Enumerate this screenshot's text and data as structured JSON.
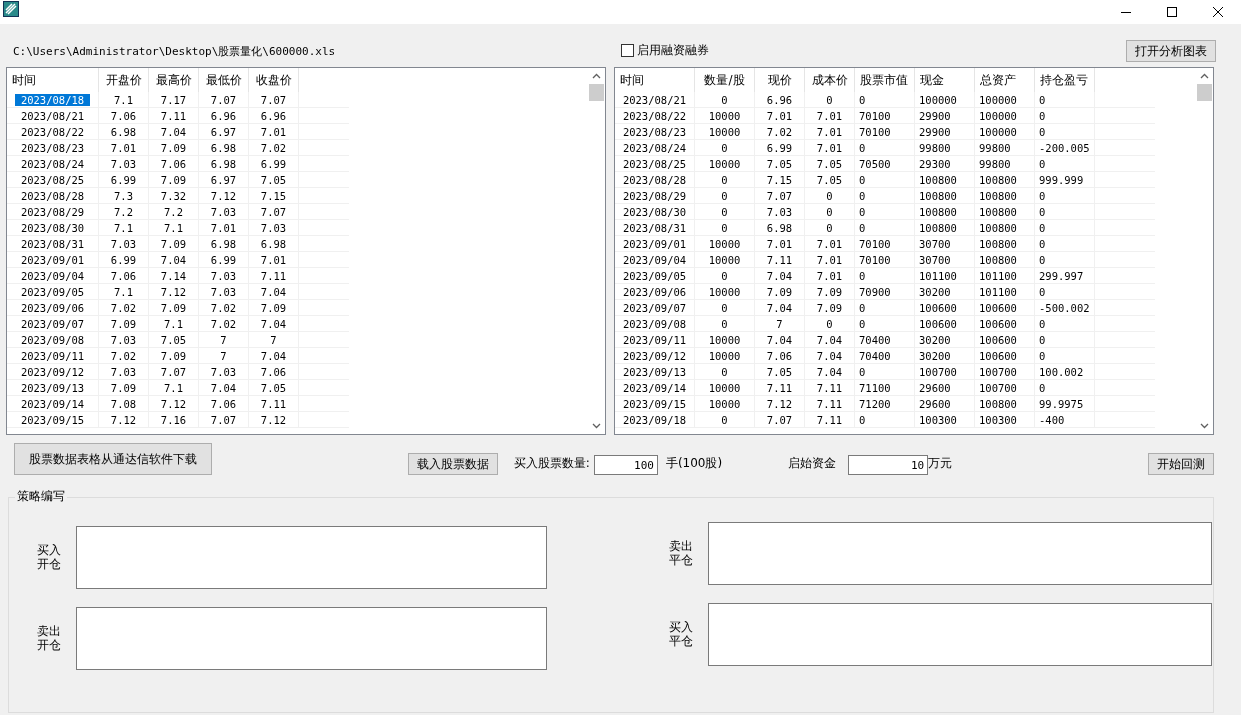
{
  "file_path": "C:\\Users\\Administrator\\Desktop\\股票量化\\600000.xls",
  "margin_option": {
    "label": "启用融资融券",
    "checked": false
  },
  "chart_button": "打开分析图表",
  "price_table": {
    "columns": [
      "时间",
      "开盘价",
      "最高价",
      "最低价",
      "收盘价"
    ],
    "rows": [
      {
        "selected": true,
        "cells": [
          "2023/08/18",
          "7.1",
          "7.17",
          "7.07",
          "7.07"
        ]
      },
      {
        "selected": false,
        "cells": [
          "2023/08/21",
          "7.06",
          "7.11",
          "6.96",
          "6.96"
        ]
      },
      {
        "selected": false,
        "cells": [
          "2023/08/22",
          "6.98",
          "7.04",
          "6.97",
          "7.01"
        ]
      },
      {
        "selected": false,
        "cells": [
          "2023/08/23",
          "7.01",
          "7.09",
          "6.98",
          "7.02"
        ]
      },
      {
        "selected": false,
        "cells": [
          "2023/08/24",
          "7.03",
          "7.06",
          "6.98",
          "6.99"
        ]
      },
      {
        "selected": false,
        "cells": [
          "2023/08/25",
          "6.99",
          "7.09",
          "6.97",
          "7.05"
        ]
      },
      {
        "selected": false,
        "cells": [
          "2023/08/28",
          "7.3",
          "7.32",
          "7.12",
          "7.15"
        ]
      },
      {
        "selected": false,
        "cells": [
          "2023/08/29",
          "7.2",
          "7.2",
          "7.03",
          "7.07"
        ]
      },
      {
        "selected": false,
        "cells": [
          "2023/08/30",
          "7.1",
          "7.1",
          "7.01",
          "7.03"
        ]
      },
      {
        "selected": false,
        "cells": [
          "2023/08/31",
          "7.03",
          "7.09",
          "6.98",
          "6.98"
        ]
      },
      {
        "selected": false,
        "cells": [
          "2023/09/01",
          "6.99",
          "7.04",
          "6.99",
          "7.01"
        ]
      },
      {
        "selected": false,
        "cells": [
          "2023/09/04",
          "7.06",
          "7.14",
          "7.03",
          "7.11"
        ]
      },
      {
        "selected": false,
        "cells": [
          "2023/09/05",
          "7.1",
          "7.12",
          "7.03",
          "7.04"
        ]
      },
      {
        "selected": false,
        "cells": [
          "2023/09/06",
          "7.02",
          "7.09",
          "7.02",
          "7.09"
        ]
      },
      {
        "selected": false,
        "cells": [
          "2023/09/07",
          "7.09",
          "7.1",
          "7.02",
          "7.04"
        ]
      },
      {
        "selected": false,
        "cells": [
          "2023/09/08",
          "7.03",
          "7.05",
          "7",
          "7"
        ]
      },
      {
        "selected": false,
        "cells": [
          "2023/09/11",
          "7.02",
          "7.09",
          "7",
          "7.04"
        ]
      },
      {
        "selected": false,
        "cells": [
          "2023/09/12",
          "7.03",
          "7.07",
          "7.03",
          "7.06"
        ]
      },
      {
        "selected": false,
        "cells": [
          "2023/09/13",
          "7.09",
          "7.1",
          "7.04",
          "7.05"
        ]
      },
      {
        "selected": false,
        "cells": [
          "2023/09/14",
          "7.08",
          "7.12",
          "7.06",
          "7.11"
        ]
      },
      {
        "selected": false,
        "cells": [
          "2023/09/15",
          "7.12",
          "7.16",
          "7.07",
          "7.12"
        ]
      }
    ]
  },
  "result_table": {
    "columns": [
      "时间",
      "数量/股",
      "现价",
      "成本价",
      "股票市值",
      "现金",
      "总资产",
      "持仓盈亏"
    ],
    "rows": [
      {
        "selected": false,
        "cells": [
          "2023/08/21",
          "0",
          "6.96",
          "0",
          "0",
          "100000",
          "100000",
          "0"
        ]
      },
      {
        "selected": false,
        "cells": [
          "2023/08/22",
          "10000",
          "7.01",
          "7.01",
          "70100",
          "29900",
          "100000",
          "0"
        ]
      },
      {
        "selected": false,
        "cells": [
          "2023/08/23",
          "10000",
          "7.02",
          "7.01",
          "70100",
          "29900",
          "100000",
          "0"
        ]
      },
      {
        "selected": false,
        "cells": [
          "2023/08/24",
          "0",
          "6.99",
          "7.01",
          "0",
          "99800",
          "99800",
          "-200.005"
        ]
      },
      {
        "selected": false,
        "cells": [
          "2023/08/25",
          "10000",
          "7.05",
          "7.05",
          "70500",
          "29300",
          "99800",
          "0"
        ]
      },
      {
        "selected": false,
        "cells": [
          "2023/08/28",
          "0",
          "7.15",
          "7.05",
          "0",
          "100800",
          "100800",
          "999.999"
        ]
      },
      {
        "selected": false,
        "cells": [
          "2023/08/29",
          "0",
          "7.07",
          "0",
          "0",
          "100800",
          "100800",
          "0"
        ]
      },
      {
        "selected": false,
        "cells": [
          "2023/08/30",
          "0",
          "7.03",
          "0",
          "0",
          "100800",
          "100800",
          "0"
        ]
      },
      {
        "selected": false,
        "cells": [
          "2023/08/31",
          "0",
          "6.98",
          "0",
          "0",
          "100800",
          "100800",
          "0"
        ]
      },
      {
        "selected": false,
        "cells": [
          "2023/09/01",
          "10000",
          "7.01",
          "7.01",
          "70100",
          "30700",
          "100800",
          "0"
        ]
      },
      {
        "selected": false,
        "cells": [
          "2023/09/04",
          "10000",
          "7.11",
          "7.01",
          "70100",
          "30700",
          "100800",
          "0"
        ]
      },
      {
        "selected": false,
        "cells": [
          "2023/09/05",
          "0",
          "7.04",
          "7.01",
          "0",
          "101100",
          "101100",
          "299.997"
        ]
      },
      {
        "selected": false,
        "cells": [
          "2023/09/06",
          "10000",
          "7.09",
          "7.09",
          "70900",
          "30200",
          "101100",
          "0"
        ]
      },
      {
        "selected": false,
        "cells": [
          "2023/09/07",
          "0",
          "7.04",
          "7.09",
          "0",
          "100600",
          "100600",
          "-500.002"
        ]
      },
      {
        "selected": false,
        "cells": [
          "2023/09/08",
          "0",
          "7",
          "0",
          "0",
          "100600",
          "100600",
          "0"
        ]
      },
      {
        "selected": false,
        "cells": [
          "2023/09/11",
          "10000",
          "7.04",
          "7.04",
          "70400",
          "30200",
          "100600",
          "0"
        ]
      },
      {
        "selected": false,
        "cells": [
          "2023/09/12",
          "10000",
          "7.06",
          "7.04",
          "70400",
          "30200",
          "100600",
          "0"
        ]
      },
      {
        "selected": false,
        "cells": [
          "2023/09/13",
          "0",
          "7.05",
          "7.04",
          "0",
          "100700",
          "100700",
          "100.002"
        ]
      },
      {
        "selected": false,
        "cells": [
          "2023/09/14",
          "10000",
          "7.11",
          "7.11",
          "71100",
          "29600",
          "100700",
          "0"
        ]
      },
      {
        "selected": false,
        "cells": [
          "2023/09/15",
          "10000",
          "7.12",
          "7.11",
          "71200",
          "29600",
          "100800",
          "99.9975"
        ]
      },
      {
        "selected": false,
        "cells": [
          "2023/09/18",
          "0",
          "7.07",
          "7.11",
          "0",
          "100300",
          "100300",
          "-400"
        ]
      }
    ]
  },
  "download_button": "股票数据表格从通达信软件下载",
  "load_button": "载入股票数据",
  "buy_quantity": {
    "label": "买入股票数量:",
    "value": "100",
    "unit": "手(100股)"
  },
  "start_capital": {
    "label": "启始资金",
    "value": "10",
    "unit": "万元"
  },
  "backtest_button": "开始回测",
  "strategy": {
    "title": "策略编写",
    "fields": [
      {
        "label": "买入开仓"
      },
      {
        "label": "卖出平仓"
      },
      {
        "label": "卖出开仓"
      },
      {
        "label": "买入平仓"
      }
    ]
  }
}
